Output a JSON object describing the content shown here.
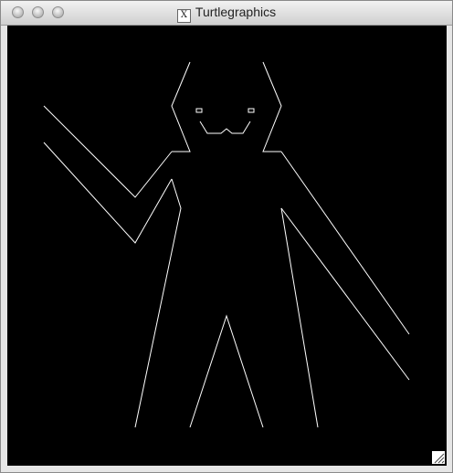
{
  "window": {
    "title": "Turtlegraphics",
    "title_icon_glyph": "X"
  },
  "controls": {
    "close": "close-button",
    "minimize": "minimize-button",
    "zoom": "zoom-button"
  },
  "drawing": {
    "stroke_color": "#ffffff",
    "background_color": "#000000",
    "subject": "stick-figure-with-sword"
  },
  "colors": {
    "titlebar_top": "#f2f2f2",
    "titlebar_bottom": "#cfcfcf",
    "canvas": "#000000",
    "line": "#ffffff"
  }
}
